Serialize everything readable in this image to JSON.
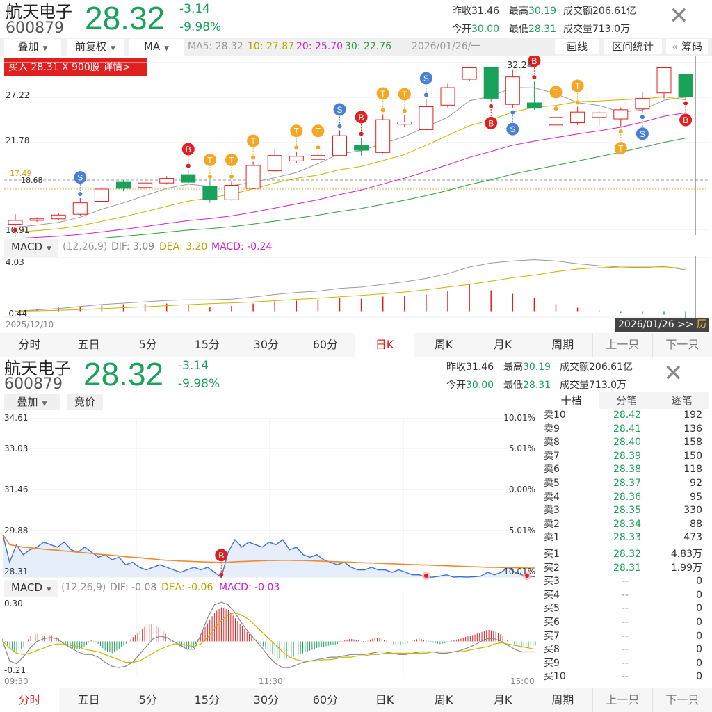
{
  "stock": {
    "name": "航天电子",
    "code": "600879",
    "price": "28.32",
    "change": "-3.14",
    "change_pct": "-9.98%"
  },
  "stats": {
    "prev_close_label": "昨收",
    "prev_close": "31.46",
    "high_label": "最高",
    "high": "30.19",
    "turnover_label": "成交额",
    "turnover": "206.61亿",
    "open_label": "今开",
    "open": "30.00",
    "low_label": "最低",
    "low": "28.31",
    "volume_label": "成交量",
    "volume": "713.0万"
  },
  "toolbar1": {
    "overlay": "叠加",
    "adjust": "前复权",
    "indicator": "MA",
    "ma5": "MA5: 28.32",
    "ma10": "10: 27.87",
    "ma20": "20: 25.70",
    "ma30": "30: 22.76",
    "date": "2026/01/26/一",
    "draw": "画线",
    "interval_stats": "区间统计",
    "chips_prefix": "«",
    "chips": "筹码"
  },
  "buy_banner": "买入 28.31 X  900股  详情>",
  "kline": {
    "y_labels": [
      "27.22",
      "21.78",
      "10.91"
    ],
    "price_tag": "17.49",
    "price_tag2": "18.68",
    "peak_label": "32.24",
    "start_date": "2025/12/10",
    "end_date": "2026/01/26 >>",
    "end_suffix": "历",
    "macd_title": "MACD",
    "macd_params": "(12,26,9)",
    "dif": "DIF: 3.09",
    "dea": "DEA: 3.20",
    "macd": "MACD: -0.24",
    "macd_hi": "4.03",
    "macd_lo": "-0.44"
  },
  "tabs1": [
    "分时",
    "五日",
    "5分",
    "15分",
    "30分",
    "60分",
    "日K",
    "周K",
    "月K",
    "周期",
    "上一只",
    "下一只"
  ],
  "toolbar2": {
    "overlay": "叠加",
    "auction": "竞价"
  },
  "intraday": {
    "y_labels": [
      "34.61",
      "33.03",
      "31.46",
      "29.88",
      "28.31"
    ],
    "pct_labels": [
      "10.01%",
      "5.01%",
      "0.00%",
      "-5.01%",
      "-10.01%"
    ],
    "macd_title": "MACD",
    "macd_params": "(12,26,9)",
    "dif": "DIF: -0.08",
    "dea": "DEA: -0.06",
    "macd": "MACD: -0.03",
    "macd_hi": "0.30",
    "macd_lo": "-0.21",
    "t_start": "09:30",
    "t_mid": "11:30",
    "t_end": "15:00"
  },
  "orderbook": {
    "tabs": [
      "十档",
      "分笔",
      "逐笔"
    ],
    "asks": [
      {
        "label": "卖10",
        "price": "28.42",
        "vol": "192"
      },
      {
        "label": "卖9",
        "price": "28.41",
        "vol": "136"
      },
      {
        "label": "卖8",
        "price": "28.40",
        "vol": "158"
      },
      {
        "label": "卖7",
        "price": "28.39",
        "vol": "150"
      },
      {
        "label": "卖6",
        "price": "28.38",
        "vol": "118"
      },
      {
        "label": "卖5",
        "price": "28.37",
        "vol": "92"
      },
      {
        "label": "卖4",
        "price": "28.36",
        "vol": "95"
      },
      {
        "label": "卖3",
        "price": "28.35",
        "vol": "330"
      },
      {
        "label": "卖2",
        "price": "28.34",
        "vol": "88"
      },
      {
        "label": "卖1",
        "price": "28.33",
        "vol": "473"
      }
    ],
    "bids": [
      {
        "label": "买1",
        "price": "28.32",
        "vol": "4.83万"
      },
      {
        "label": "买2",
        "price": "28.31",
        "vol": "1.99万"
      },
      {
        "label": "买3",
        "price": "--",
        "vol": "0"
      },
      {
        "label": "买4",
        "price": "--",
        "vol": "0"
      },
      {
        "label": "买5",
        "price": "--",
        "vol": "0"
      },
      {
        "label": "买6",
        "price": "--",
        "vol": "0"
      },
      {
        "label": "买7",
        "price": "--",
        "vol": "0"
      },
      {
        "label": "买8",
        "price": "--",
        "vol": "0"
      },
      {
        "label": "买9",
        "price": "--",
        "vol": "0"
      },
      {
        "label": "买10",
        "price": "--",
        "vol": "0"
      }
    ]
  },
  "tabs2": [
    "分时",
    "五日",
    "5分",
    "15分",
    "30分",
    "60分",
    "日K",
    "周K",
    "月K",
    "周期",
    "上一只",
    "下一只"
  ],
  "colors": {
    "up": "#e02020",
    "down": "#1aa15a",
    "ma5": "#999999",
    "ma10": "#c8b400",
    "ma20": "#d020c8",
    "ma30": "#2e9e3a",
    "price_line": "#3a6fd8",
    "avg_line": "#f08a30"
  },
  "kline_candles": [
    {
      "o": 11.6,
      "c": 12.1,
      "h": 12.9,
      "l": 11.4
    },
    {
      "o": 12.1,
      "c": 12.3,
      "h": 12.5,
      "l": 11.9
    },
    {
      "o": 12.3,
      "c": 12.8,
      "h": 13.1,
      "l": 12.1
    },
    {
      "o": 12.9,
      "c": 14.4,
      "h": 15.0,
      "l": 12.7
    },
    {
      "o": 14.6,
      "c": 16.2,
      "h": 16.6,
      "l": 14.4
    },
    {
      "o": 17.1,
      "c": 16.3,
      "h": 17.4,
      "l": 15.9
    },
    {
      "o": 16.4,
      "c": 17.0,
      "h": 17.6,
      "l": 16.0
    },
    {
      "o": 17.0,
      "c": 17.6,
      "h": 17.9,
      "l": 16.8
    },
    {
      "o": 18.1,
      "c": 17.1,
      "h": 18.7,
      "l": 16.9
    },
    {
      "o": 16.6,
      "c": 14.8,
      "h": 17.3,
      "l": 14.4
    },
    {
      "o": 14.8,
      "c": 16.7,
      "h": 17.3,
      "l": 14.7
    },
    {
      "o": 16.3,
      "c": 19.3,
      "h": 19.8,
      "l": 16.2
    },
    {
      "o": 18.6,
      "c": 20.6,
      "h": 21.4,
      "l": 18.4
    },
    {
      "o": 19.9,
      "c": 20.5,
      "h": 21.1,
      "l": 19.6
    },
    {
      "o": 20.1,
      "c": 20.6,
      "h": 21.1,
      "l": 20.0
    },
    {
      "o": 20.6,
      "c": 23.2,
      "h": 23.9,
      "l": 20.6
    },
    {
      "o": 21.9,
      "c": 21.3,
      "h": 22.9,
      "l": 20.6
    },
    {
      "o": 21.0,
      "c": 25.3,
      "h": 26.0,
      "l": 20.9
    },
    {
      "o": 24.7,
      "c": 25.0,
      "h": 25.9,
      "l": 24.4
    },
    {
      "o": 24.0,
      "c": 27.0,
      "h": 28.0,
      "l": 23.9
    },
    {
      "o": 27.2,
      "c": 29.5,
      "h": 30.0,
      "l": 26.9
    },
    {
      "o": 30.6,
      "c": 32.1,
      "h": 32.24,
      "l": 30.4
    },
    {
      "o": 32.2,
      "c": 28.1,
      "h": 32.24,
      "l": 27.6
    },
    {
      "o": 27.3,
      "c": 30.9,
      "h": 31.9,
      "l": 26.8
    },
    {
      "o": 27.5,
      "c": 26.8,
      "h": 30.3,
      "l": 26.6
    },
    {
      "o": 24.6,
      "c": 25.6,
      "h": 26.2,
      "l": 24.3
    },
    {
      "o": 24.9,
      "c": 26.3,
      "h": 27.0,
      "l": 24.6
    },
    {
      "o": 25.6,
      "c": 26.2,
      "h": 26.5,
      "l": 24.5
    },
    {
      "o": 25.4,
      "c": 26.6,
      "h": 26.9,
      "l": 24.3
    },
    {
      "o": 26.7,
      "c": 28.1,
      "h": 28.9,
      "l": 26.2
    },
    {
      "o": 28.8,
      "c": 32.1,
      "h": 32.2,
      "l": 28.1
    },
    {
      "o": 31.2,
      "c": 28.3,
      "h": 31.3,
      "l": 28.0
    }
  ],
  "kline_macd": [
    0.02,
    0.07,
    0.1,
    0.14,
    0.18,
    0.2,
    0.21,
    0.22,
    0.18,
    0.13,
    0.15,
    0.22,
    0.28,
    0.3,
    0.31,
    0.38,
    0.36,
    0.42,
    0.44,
    0.48,
    0.57,
    0.78,
    0.6,
    0.5,
    0.38,
    0.2,
    0.1,
    0.02,
    -0.05,
    -0.08,
    -0.1,
    -0.24
  ],
  "kline_dif": [
    0.0,
    0.1,
    0.2,
    0.35,
    0.5,
    0.6,
    0.7,
    0.8,
    0.85,
    0.85,
    0.9,
    1.05,
    1.25,
    1.4,
    1.5,
    1.7,
    1.8,
    2.0,
    2.2,
    2.45,
    2.8,
    3.3,
    3.6,
    3.75,
    3.85,
    3.75,
    3.55,
    3.4,
    3.3,
    3.25,
    3.35,
    3.09
  ],
  "kline_dea": [
    0.0,
    0.03,
    0.07,
    0.12,
    0.19,
    0.26,
    0.33,
    0.41,
    0.49,
    0.56,
    0.62,
    0.69,
    0.78,
    0.88,
    0.97,
    1.07,
    1.18,
    1.3,
    1.43,
    1.6,
    1.8,
    2.0,
    2.25,
    2.5,
    2.7,
    2.95,
    3.15,
    3.25,
    3.3,
    3.3,
    3.32,
    3.2
  ],
  "kline_markers": [
    {
      "i": 0,
      "t": "B",
      "pos": "below"
    },
    {
      "i": 3,
      "t": "S",
      "pos": "above"
    },
    {
      "i": 8,
      "t": "B",
      "pos": "above"
    },
    {
      "i": 9,
      "t": "T",
      "pos": "above"
    },
    {
      "i": 10,
      "t": "T",
      "pos": "above"
    },
    {
      "i": 11,
      "t": "T",
      "pos": "above"
    },
    {
      "i": 13,
      "t": "T",
      "pos": "above"
    },
    {
      "i": 14,
      "t": "T",
      "pos": "above"
    },
    {
      "i": 15,
      "t": "S",
      "pos": "above"
    },
    {
      "i": 16,
      "t": "B",
      "pos": "above"
    },
    {
      "i": 17,
      "t": "T",
      "pos": "above"
    },
    {
      "i": 18,
      "t": "T",
      "pos": "above"
    },
    {
      "i": 19,
      "t": "S",
      "pos": "above"
    },
    {
      "i": 22,
      "t": "B",
      "pos": "below"
    },
    {
      "i": 23,
      "t": "S",
      "pos": "below"
    },
    {
      "i": 24,
      "t": "B",
      "pos": "above"
    },
    {
      "i": 25,
      "t": "T",
      "pos": "above"
    },
    {
      "i": 26,
      "t": "T",
      "pos": "above"
    },
    {
      "i": 28,
      "t": "T",
      "pos": "below"
    },
    {
      "i": 29,
      "t": "S",
      "pos": "below"
    },
    {
      "i": 31,
      "t": "B",
      "pos": "below"
    }
  ],
  "intraday_price": [
    30.0,
    28.9,
    29.6,
    29.2,
    29.4,
    29.5,
    29.7,
    29.6,
    29.5,
    29.7,
    29.4,
    29.3,
    29.5,
    29.3,
    29.1,
    29.2,
    29.0,
    29.1,
    28.8,
    28.9,
    28.7,
    28.6,
    28.7,
    28.8,
    28.7,
    28.6,
    28.5,
    28.6,
    28.7,
    28.6,
    28.7,
    28.5,
    28.3,
    29.3,
    29.8,
    29.5,
    29.7,
    29.6,
    29.5,
    29.7,
    29.6,
    29.8,
    29.4,
    29.5,
    29.2,
    29.1,
    29.2,
    29.0,
    28.9,
    28.8,
    28.9,
    28.7,
    28.6,
    28.6,
    28.7,
    28.6,
    28.6,
    28.5,
    28.6,
    28.5,
    28.4,
    28.4,
    28.3,
    28.31,
    28.35,
    28.4,
    28.31,
    28.32,
    28.31,
    28.32,
    28.35,
    28.5,
    28.4,
    28.5,
    28.7,
    28.5,
    28.4,
    28.35,
    28.32
  ],
  "intraday_avg": [
    30.0,
    29.6,
    29.55,
    29.5,
    29.48,
    29.45,
    29.42,
    29.4,
    29.38,
    29.35,
    29.33,
    29.3,
    29.28,
    29.25,
    29.22,
    29.2,
    29.18,
    29.15,
    29.12,
    29.1,
    29.08,
    29.05,
    29.03,
    29.0,
    28.98,
    28.97,
    28.95,
    28.94,
    28.93,
    28.92,
    28.91,
    28.9,
    28.89,
    28.9,
    28.92,
    28.93,
    28.94,
    28.95,
    28.96,
    28.97,
    28.97,
    28.98,
    28.98,
    28.97,
    28.97,
    28.96,
    28.95,
    28.94,
    28.93,
    28.92,
    28.91,
    28.9,
    28.89,
    28.88,
    28.87,
    28.86,
    28.85,
    28.84,
    28.83,
    28.82,
    28.81,
    28.8,
    28.79,
    28.78,
    28.77,
    28.76,
    28.75,
    28.74,
    28.73,
    28.72,
    28.71,
    28.7,
    28.7,
    28.69,
    28.69,
    28.68,
    28.68,
    28.67,
    28.67
  ],
  "intraday_macd": [
    0.02,
    -0.06,
    -0.08,
    -0.05,
    0.04,
    0.06,
    0.04,
    0.05,
    0.03,
    -0.02,
    -0.05,
    -0.06,
    -0.04,
    0.01,
    -0.02,
    -0.07,
    -0.09,
    -0.06,
    -0.02,
    0.03,
    0.08,
    0.12,
    0.14,
    0.1,
    0.05,
    -0.01,
    -0.04,
    -0.06,
    -0.05,
    0.06,
    0.14,
    0.22,
    0.26,
    0.24,
    0.18,
    0.12,
    0.06,
    0.02,
    -0.03,
    -0.08,
    -0.12,
    -0.14,
    -0.13,
    -0.11,
    -0.09,
    -0.07,
    -0.05,
    -0.04,
    -0.03,
    -0.02,
    0.01,
    0.02,
    0.01,
    -0.01,
    0.02,
    0.03,
    0.01,
    -0.02,
    -0.03,
    -0.02,
    0.01,
    0.02,
    0.01,
    -0.01,
    -0.02,
    -0.01,
    0.01,
    0.02,
    0.04,
    0.05,
    0.07,
    0.09,
    0.08,
    0.05,
    0.01,
    -0.03,
    -0.05,
    -0.04,
    -0.03
  ],
  "intraday_dif": [
    0.0,
    -0.15,
    -0.17,
    -0.12,
    -0.05,
    0.0,
    0.02,
    0.03,
    0.02,
    -0.02,
    -0.05,
    -0.08,
    -0.1,
    -0.1,
    -0.12,
    -0.16,
    -0.19,
    -0.2,
    -0.19,
    -0.16,
    -0.1,
    -0.04,
    0.02,
    0.04,
    0.03,
    0.0,
    -0.03,
    -0.06,
    -0.06,
    0.05,
    0.18,
    0.28,
    0.3,
    0.28,
    0.22,
    0.14,
    0.07,
    0.01,
    -0.05,
    -0.12,
    -0.17,
    -0.2,
    -0.2,
    -0.18,
    -0.16,
    -0.15,
    -0.14,
    -0.13,
    -0.12,
    -0.12,
    -0.11,
    -0.1,
    -0.1,
    -0.1,
    -0.09,
    -0.08,
    -0.08,
    -0.09,
    -0.1,
    -0.1,
    -0.09,
    -0.08,
    -0.08,
    -0.08,
    -0.09,
    -0.09,
    -0.08,
    -0.07,
    -0.05,
    -0.03,
    0.0,
    0.02,
    0.02,
    0.0,
    -0.03,
    -0.06,
    -0.08,
    -0.08,
    -0.08
  ],
  "intraday_dea": [
    0.0,
    -0.05,
    -0.09,
    -0.1,
    -0.09,
    -0.07,
    -0.05,
    -0.03,
    -0.02,
    -0.02,
    -0.03,
    -0.04,
    -0.06,
    -0.07,
    -0.08,
    -0.1,
    -0.12,
    -0.14,
    -0.16,
    -0.16,
    -0.15,
    -0.12,
    -0.09,
    -0.06,
    -0.04,
    -0.02,
    -0.02,
    -0.03,
    -0.04,
    -0.02,
    0.03,
    0.1,
    0.16,
    0.2,
    0.22,
    0.2,
    0.17,
    0.12,
    0.07,
    0.02,
    -0.03,
    -0.08,
    -0.12,
    -0.14,
    -0.15,
    -0.15,
    -0.15,
    -0.14,
    -0.14,
    -0.13,
    -0.12,
    -0.12,
    -0.11,
    -0.11,
    -0.1,
    -0.1,
    -0.09,
    -0.09,
    -0.09,
    -0.09,
    -0.09,
    -0.09,
    -0.09,
    -0.08,
    -0.08,
    -0.08,
    -0.08,
    -0.08,
    -0.07,
    -0.06,
    -0.05,
    -0.04,
    -0.02,
    -0.01,
    -0.02,
    -0.03,
    -0.04,
    -0.05,
    -0.06
  ]
}
